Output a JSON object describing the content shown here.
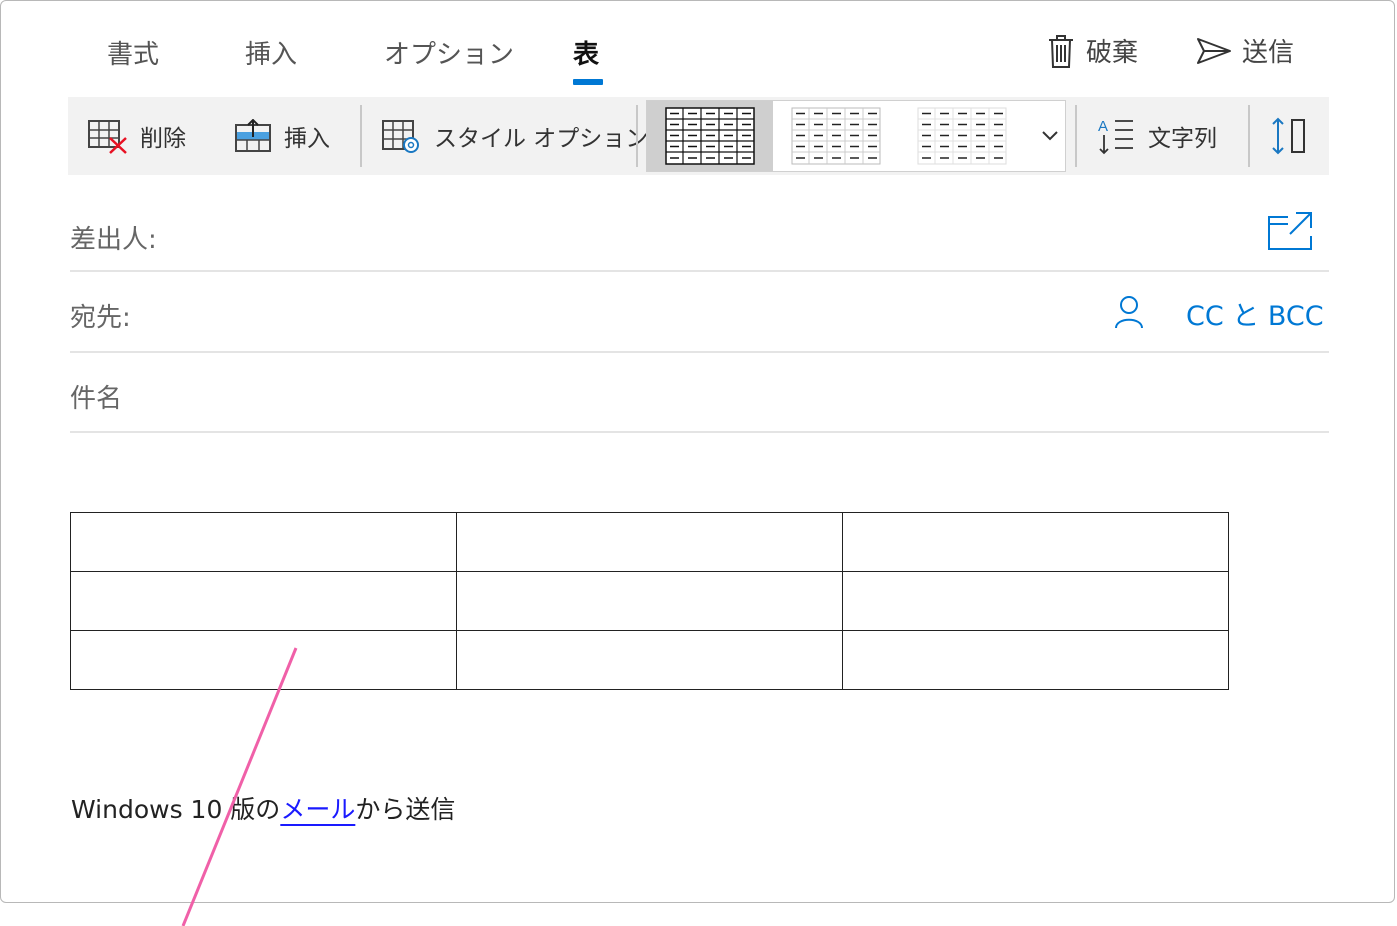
{
  "tabs": [
    {
      "label": "書式"
    },
    {
      "label": "挿入"
    },
    {
      "label": "オプション"
    },
    {
      "label": "表"
    }
  ],
  "actions": {
    "discard_label": "破棄",
    "send_label": "送信"
  },
  "ribbon": {
    "delete_label": "削除",
    "insert_label": "挿入",
    "style_options_label": "スタイル オプション",
    "text_direction_label": "文字列"
  },
  "fields": {
    "from_label": "差出人:",
    "to_label": "宛先:",
    "cc_bcc_label": "CC と BCC",
    "subject_label": "件名"
  },
  "table": {
    "rows": 3,
    "cols": 3
  },
  "signature": {
    "before": "Windows 10 版の",
    "link": "メール",
    "after": "から送信"
  },
  "colors": {
    "accent": "#0078d4",
    "annotation": "#f060a8",
    "delete_x": "#e81123"
  }
}
